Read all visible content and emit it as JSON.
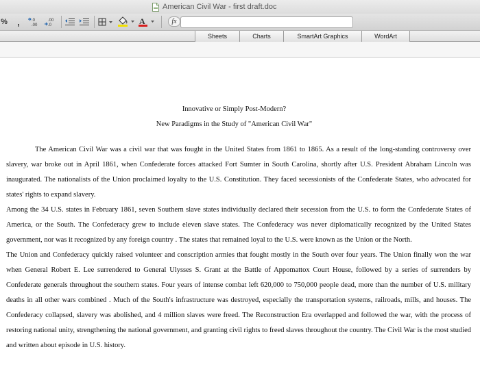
{
  "window": {
    "title": "American Civil War - first draft.doc"
  },
  "toolbar": {
    "percent_label": "%",
    "comma_label": ",",
    "fx_label": "fx",
    "formula_value": ""
  },
  "ribbon": {
    "tabs": [
      "Sheets",
      "Charts",
      "SmartArt Graphics",
      "WordArt"
    ]
  },
  "document": {
    "title": "Innovative or Simply Post-Modern?",
    "subtitle": "New Paradigms in the Study of \"American Civil War\"",
    "paragraphs": [
      "The American Civil War  was a civil war that was fought in the United States from 1861 to 1865. As a result of the long-standing controversy over slavery, war broke out in April 1861, when Confederate forces attacked Fort Sumter in South Carolina, shortly after U.S. President Abraham Lincoln was inaugurated. The nationalists of the Union proclaimed loyalty to the U.S. Constitution. They faced secessionists of the Confederate States, who advocated for states' rights to expand slavery.",
      "Among the 34 U.S. states in February 1861, seven Southern slave states individually declared their secession from the U.S. to form the Confederate States of America, or the South. The Confederacy grew to include eleven slave states. The Confederacy was never diplomatically recognized by the United States government, nor was it recognized by any foreign country . The states that remained loyal to the U.S.  were known as the Union or the North.",
      "The Union and Confederacy quickly raised volunteer and conscription armies that fought mostly in the South over four years. The Union finally won the war when General Robert E. Lee surrendered to General Ulysses S. Grant at the Battle of Appomattox Court House, followed by a series of surrenders by Confederate generals throughout the southern states. Four years of intense combat left 620,000 to 750,000 people dead, more than the number of U.S. military deaths in all other wars combined . Much of the South's infrastructure was destroyed, especially the transportation systems, railroads, mills, and houses. The Confederacy collapsed, slavery was abolished, and 4 million slaves were freed. The Reconstruction Era  overlapped and followed the war, with the process of restoring national unity, strengthening the national government, and granting civil rights to freed slaves throughout the country. The Civil War is the most studied and written about episode in U.S. history."
    ]
  }
}
